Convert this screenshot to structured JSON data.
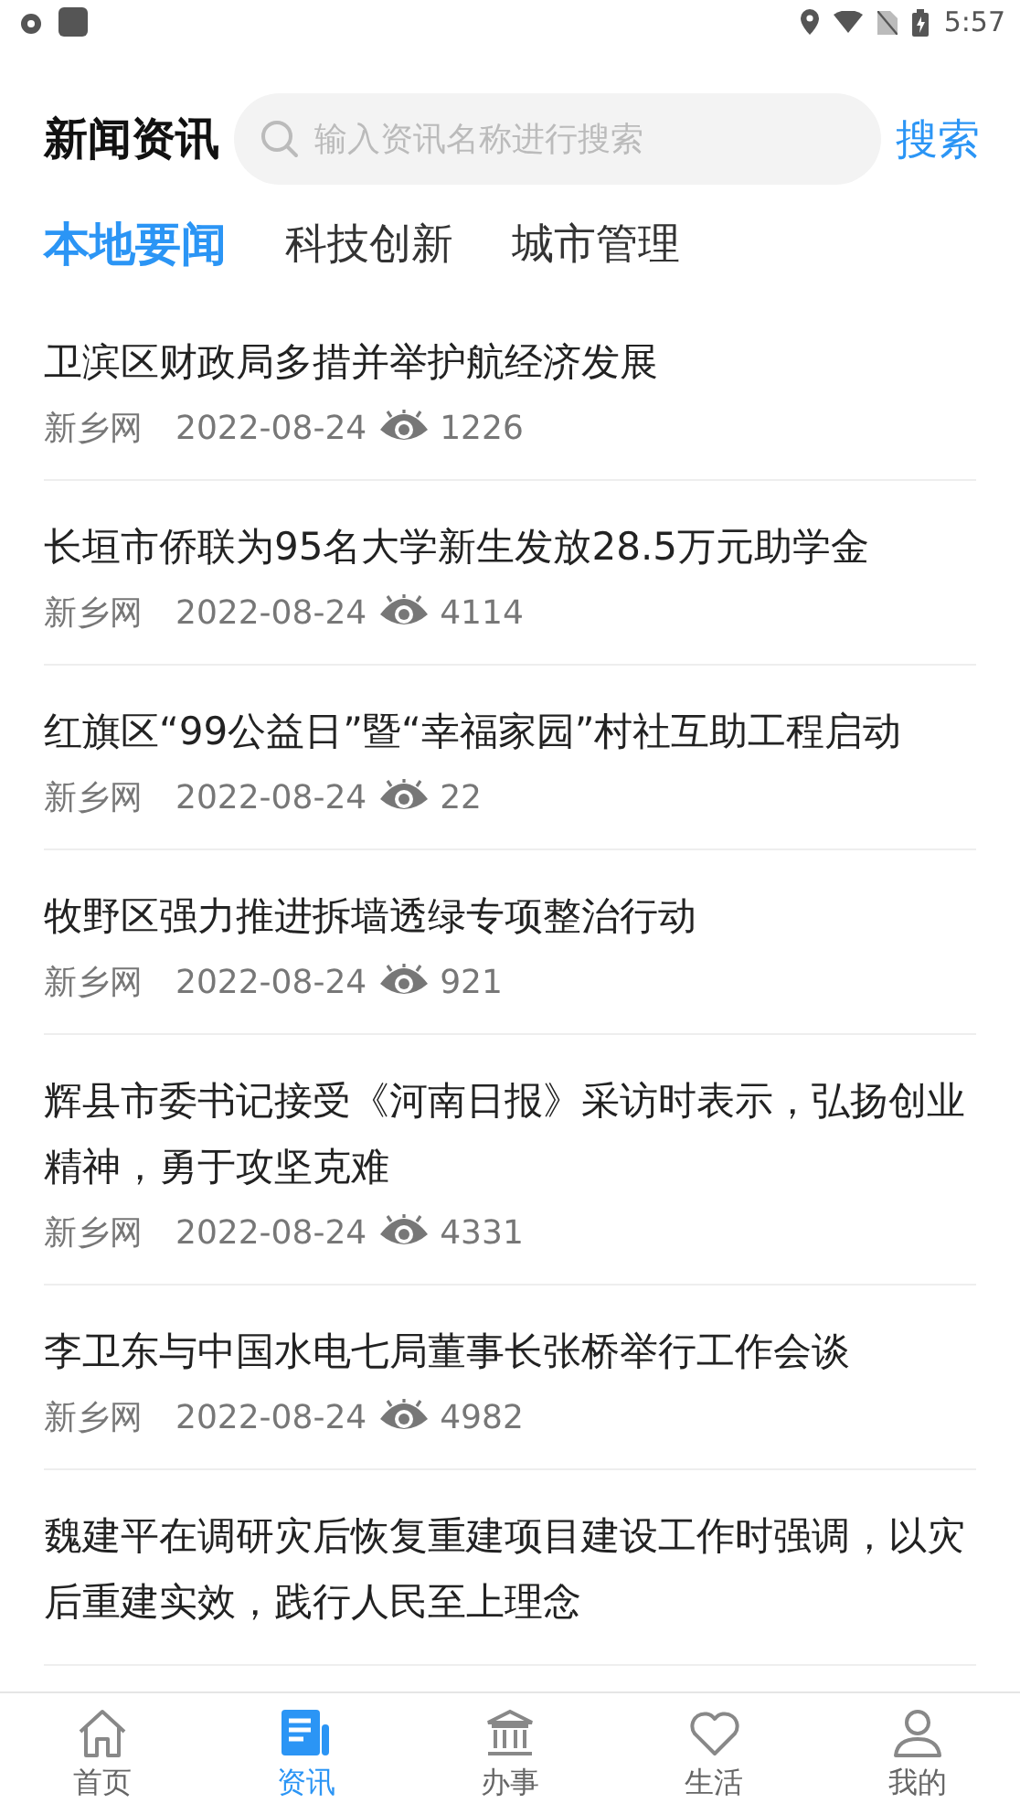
{
  "status_bar": {
    "time": "5:57"
  },
  "header": {
    "title": "新闻资讯",
    "search": {
      "placeholder": "输入资讯名称进行搜索"
    },
    "search_button": "搜索"
  },
  "tabs": [
    {
      "label": "本地要闻",
      "selected": true
    },
    {
      "label": "科技创新",
      "selected": false
    },
    {
      "label": "城市管理",
      "selected": false
    }
  ],
  "news": [
    {
      "title": "卫滨区财政局多措并举护航经济发展",
      "source": "新乡网",
      "date": "2022-08-24",
      "views": "1226"
    },
    {
      "title": "长垣市侨联为95名大学新生发放28.5万元助学金",
      "source": "新乡网",
      "date": "2022-08-24",
      "views": "4114"
    },
    {
      "title": "红旗区“99公益日”暨“幸福家园”村社互助工程启动",
      "source": "新乡网",
      "date": "2022-08-24",
      "views": "22"
    },
    {
      "title": "牧野区强力推进拆墙透绿专项整治行动",
      "source": "新乡网",
      "date": "2022-08-24",
      "views": "921"
    },
    {
      "title": "辉县市委书记接受《河南日报》采访时表示，弘扬创业精神，勇于攻坚克难",
      "source": "新乡网",
      "date": "2022-08-24",
      "views": "4331"
    },
    {
      "title": "李卫东与中国水电七局董事长张桥举行工作会谈",
      "source": "新乡网",
      "date": "2022-08-24",
      "views": "4982"
    },
    {
      "title": "魏建平在调研灾后恢复重建项目建设工作时强调，以灾后重建实效，践行人民至上理念"
    }
  ],
  "bottom_nav": [
    {
      "label": "首页",
      "kind": "home",
      "selected": false
    },
    {
      "label": "资讯",
      "kind": "news",
      "selected": true
    },
    {
      "label": "办事",
      "kind": "service",
      "selected": false
    },
    {
      "label": "生活",
      "kind": "life",
      "selected": false
    },
    {
      "label": "我的",
      "kind": "me",
      "selected": false
    }
  ]
}
